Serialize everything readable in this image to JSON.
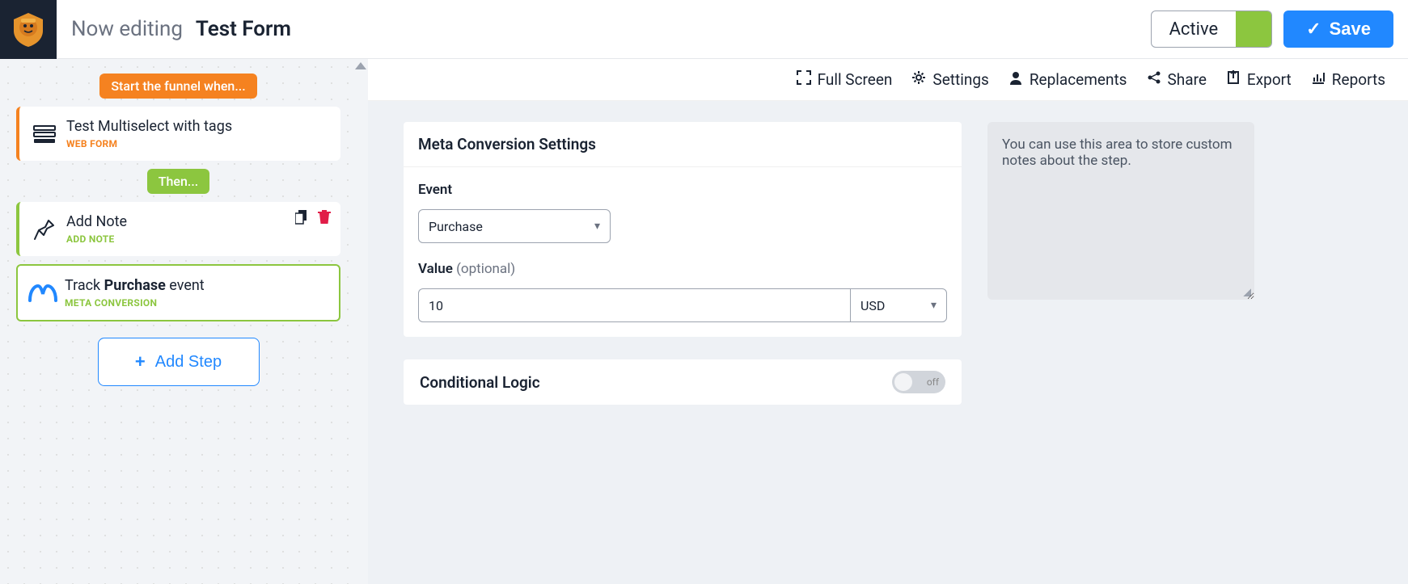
{
  "header": {
    "editing_label": "Now editing",
    "form_name": "Test Form",
    "status": "Active",
    "save_label": "Save"
  },
  "funnel": {
    "start_label": "Start the funnel when...",
    "then_label": "Then...",
    "steps": {
      "trigger": {
        "title": "Test Multiselect with tags",
        "subtitle": "WEB FORM"
      },
      "note": {
        "title": "Add Note",
        "subtitle": "ADD NOTE"
      },
      "meta": {
        "title_prefix": "Track ",
        "title_bold": "Purchase",
        "title_suffix": " event",
        "subtitle": "META CONVERSION"
      }
    },
    "add_step_label": "Add Step"
  },
  "toolbar": {
    "full_screen": "Full Screen",
    "settings": "Settings",
    "replacements": "Replacements",
    "share": "Share",
    "export": "Export",
    "reports": "Reports"
  },
  "settings_panel": {
    "title": "Meta Conversion Settings",
    "event_label": "Event",
    "event_value": "Purchase",
    "value_label": "Value ",
    "value_optional": "(optional)",
    "value_amount": "10",
    "value_currency": "USD"
  },
  "conditional": {
    "title": "Conditional Logic",
    "toggle_label": "off"
  },
  "notes": {
    "placeholder": "You can use this area to store custom notes about the step."
  }
}
